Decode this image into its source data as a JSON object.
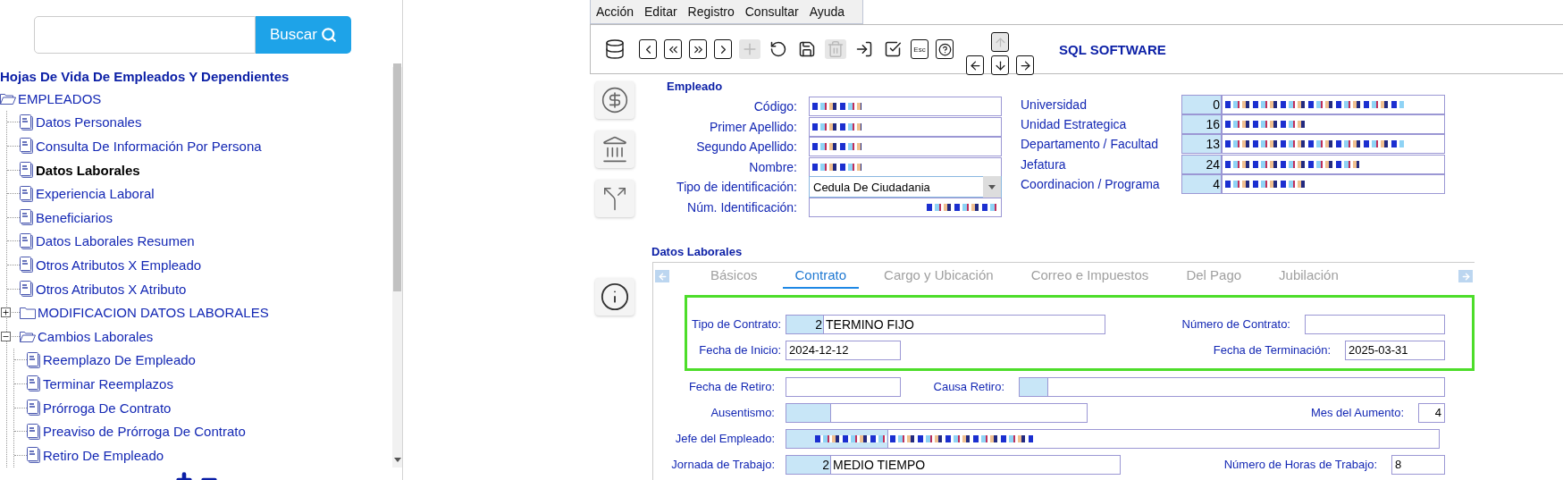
{
  "search": {
    "button": "Buscar"
  },
  "tree": {
    "title": "Hojas De Vida De Empleados Y Dependientes",
    "items": [
      {
        "label": "EMPLEADOS",
        "kind": "folder",
        "expanded": true,
        "selected": false,
        "children": [
          {
            "label": "Datos Personales",
            "kind": "document",
            "selected": false
          },
          {
            "label": "Consulta De Información Por Persona",
            "kind": "document",
            "selected": false
          },
          {
            "label": "Datos Laborales",
            "kind": "document",
            "selected": true
          },
          {
            "label": "Experiencia Laboral",
            "kind": "document",
            "selected": false
          },
          {
            "label": "Beneficiarios",
            "kind": "document",
            "selected": false
          },
          {
            "label": "Datos Laborales Resumen",
            "kind": "document",
            "selected": false
          },
          {
            "label": "Otros Atributos X Empleado",
            "kind": "document",
            "selected": false
          },
          {
            "label": "Otros Atributos X Atributo",
            "kind": "document",
            "selected": false
          },
          {
            "label": "MODIFICACION DATOS LABORALES",
            "kind": "folder",
            "expanded": false,
            "selected": false
          },
          {
            "label": "Cambios Laborales",
            "kind": "folder",
            "expanded": true,
            "selected": false,
            "children": [
              {
                "label": "Reemplazo De Empleado",
                "kind": "document",
                "selected": false
              },
              {
                "label": "Terminar Reemplazos",
                "kind": "document",
                "selected": false
              },
              {
                "label": "Prórroga De Contrato",
                "kind": "document",
                "selected": false
              },
              {
                "label": "Preaviso de Prórroga De Contrato",
                "kind": "document",
                "selected": false
              },
              {
                "label": "Retiro De Empleado",
                "kind": "document",
                "selected": false
              }
            ]
          }
        ]
      }
    ]
  },
  "menu": [
    "Acción",
    "Editar",
    "Registro",
    "Consultar",
    "Ayuda"
  ],
  "toolbar": {
    "buttons": [
      {
        "kind": "database",
        "disabled": false
      },
      {
        "kind": "prev",
        "disabled": false
      },
      {
        "kind": "first",
        "disabled": false
      },
      {
        "kind": "last",
        "disabled": false
      },
      {
        "kind": "next",
        "disabled": false
      },
      {
        "kind": "add",
        "disabled": true
      },
      {
        "kind": "undo",
        "disabled": false
      },
      {
        "kind": "save",
        "disabled": false
      },
      {
        "kind": "delete",
        "disabled": true
      },
      {
        "kind": "exit",
        "disabled": false
      },
      {
        "kind": "accept",
        "disabled": false
      },
      {
        "kind": "escape",
        "label": "Esc",
        "disabled": false
      },
      {
        "kind": "help",
        "disabled": false
      }
    ],
    "nav": [
      {
        "kind": "up",
        "disabled": true
      },
      {
        "kind": "left",
        "disabled": false
      },
      {
        "kind": "down",
        "disabled": false
      },
      {
        "kind": "right",
        "disabled": false
      }
    ],
    "brand": "SQL SOFTWARE"
  },
  "employee": {
    "title": "Empleado",
    "fields": [
      {
        "label": "Código:",
        "kind": "text",
        "redacted": true
      },
      {
        "label": "Primer Apellido:",
        "kind": "text",
        "redacted": true
      },
      {
        "label": "Segundo Apellido:",
        "kind": "text",
        "redacted": true
      },
      {
        "label": "Nombre:",
        "kind": "text",
        "redacted": true
      },
      {
        "label": "Tipo de identificación:",
        "kind": "select",
        "value": "Cedula De Ciudadania",
        "redacted": false
      },
      {
        "label": "Núm. Identificación:",
        "kind": "number",
        "redacted": true
      }
    ]
  },
  "organization": [
    {
      "label": "Universidad",
      "code": "0",
      "redacted": true
    },
    {
      "label": "Unidad Estrategica",
      "code": "16",
      "redacted": true
    },
    {
      "label": "Departamento / Facultad",
      "code": "13",
      "redacted": true
    },
    {
      "label": "Jefatura",
      "code": "24",
      "redacted": true
    },
    {
      "label": "Coordinacion / Programa",
      "code": "4",
      "redacted": true
    }
  ],
  "work_data": {
    "title": "Datos Laborales",
    "tabs": [
      {
        "label": "Básicos",
        "selected": false
      },
      {
        "label": "Contrato",
        "selected": true
      },
      {
        "label": "Cargo y Ubicación",
        "selected": false
      },
      {
        "label": "Correo e Impuestos",
        "selected": false
      },
      {
        "label": "Del Pago",
        "selected": false
      },
      {
        "label": "Jubilación",
        "selected": false
      }
    ],
    "groups": [
      {
        "highlighted": true,
        "rows": [
          {
            "fields": [
              {
                "label": "Tipo de Contrato:",
                "kind": "coded",
                "code": "2",
                "value": "TERMINO FIJO",
                "redacted": false
              },
              {
                "label": "Número de Contrato:",
                "kind": "text",
                "redacted": false
              }
            ]
          },
          {
            "fields": [
              {
                "label": "Fecha de Inicio:",
                "kind": "text",
                "value": "2024-12-12",
                "redacted": false
              },
              {
                "label": "Fecha de Terminación:",
                "kind": "text",
                "value": "2025-03-31",
                "redacted": false
              }
            ]
          }
        ]
      },
      {
        "highlighted": false,
        "rows": [
          {
            "fields": [
              {
                "label": "Fecha de Retiro:",
                "kind": "text",
                "redacted": false
              },
              {
                "label": "Causa Retiro:",
                "kind": "coded",
                "redacted": false
              }
            ]
          },
          {
            "fields": [
              {
                "label": "Ausentismo:",
                "kind": "coded",
                "redacted": false
              },
              {
                "label": "Mes del Aumento:",
                "kind": "number",
                "value": "4",
                "redacted": false
              }
            ]
          },
          {
            "fields": [
              {
                "label": "Jefe del Empleado:",
                "kind": "coded",
                "redacted": true
              }
            ]
          },
          {
            "fields": [
              {
                "label": "Jornada de Trabajo:",
                "kind": "coded",
                "code": "2",
                "value": "MEDIO TIEMPO",
                "redacted": false
              },
              {
                "label": "Número de Horas de Trabajo:",
                "kind": "text",
                "value": "8",
                "redacted": false
              }
            ]
          }
        ]
      }
    ]
  }
}
